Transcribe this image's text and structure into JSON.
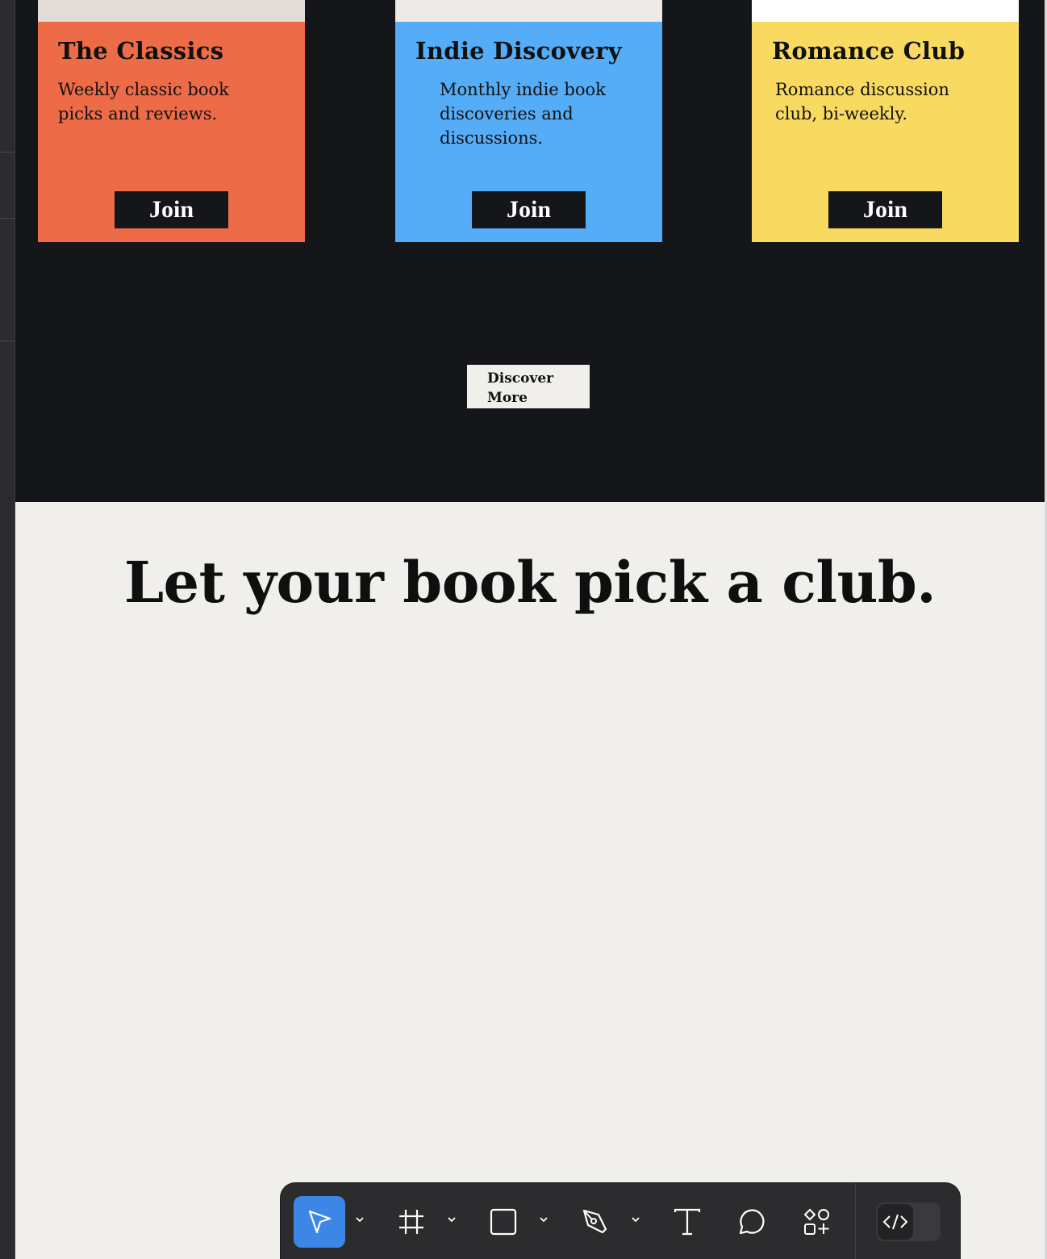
{
  "cards": [
    {
      "title": "The Classics",
      "description": "Weekly classic book picks and reviews.",
      "join_label": "Join",
      "color": "#ee6b47",
      "strip_color": "#e2dcd8"
    },
    {
      "title": "Indie Discovery",
      "description": "Monthly indie book discoveries and discussions.",
      "join_label": "Join",
      "color": "#55acf7",
      "strip_color": "#ece9e7"
    },
    {
      "title": "Romance Club",
      "description": "Romance discussion club, bi-weekly.",
      "join_label": "Join",
      "color": "#f8da60",
      "strip_color": "#ffffff"
    }
  ],
  "discover_label": "Discover More",
  "headline": "Let your book pick a club.",
  "toolbar": {
    "tools": [
      "move-tool",
      "frame-tool",
      "shape-tool",
      "pen-tool",
      "text-tool",
      "comment-tool",
      "assets-tool"
    ],
    "active_tool": "move-tool",
    "dev_mode_icon": "code-icon"
  },
  "colors": {
    "dark_bg": "#15161a",
    "light_bg": "#f0efeb",
    "accent": "#3c86e6"
  }
}
